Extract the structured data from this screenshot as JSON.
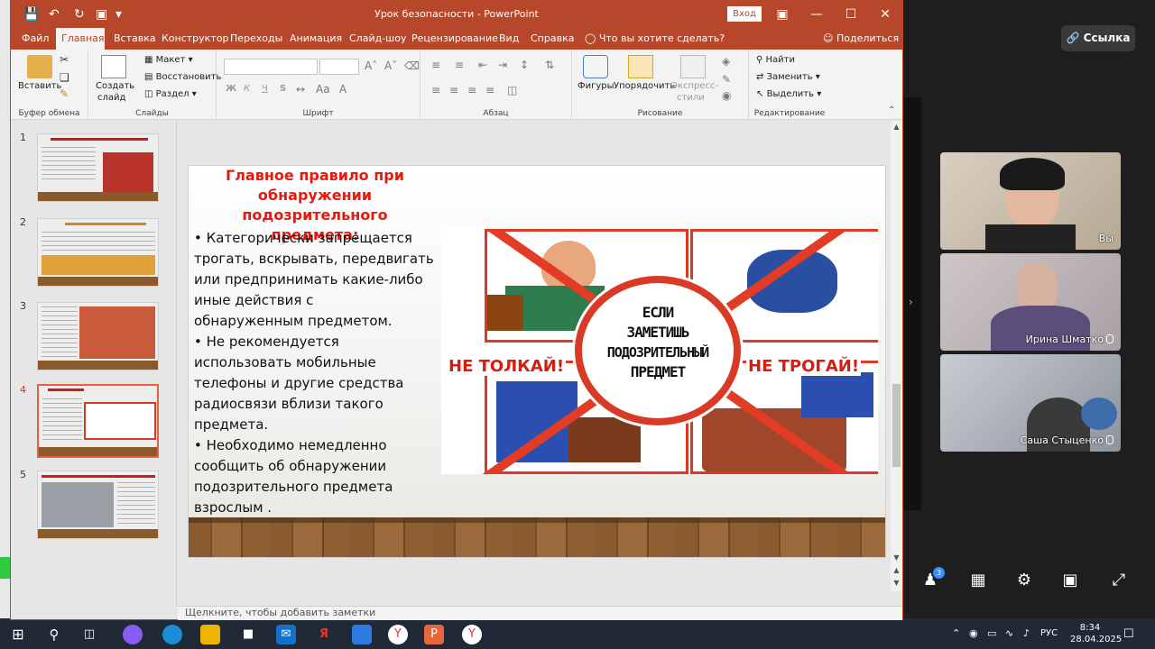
{
  "window": {
    "title": "Урок безопасности  -  PowerPoint",
    "signin": "Вход"
  },
  "tabs": [
    {
      "label": "Файл"
    },
    {
      "label": "Главная"
    },
    {
      "label": "Вставка"
    },
    {
      "label": "Конструктор"
    },
    {
      "label": "Переходы"
    },
    {
      "label": "Анимация"
    },
    {
      "label": "Слайд-шоу"
    },
    {
      "label": "Рецензирование"
    },
    {
      "label": "Вид"
    },
    {
      "label": "Справка"
    }
  ],
  "tell_me": "Что вы хотите сделать?",
  "share": "Поделиться",
  "ribbon": {
    "clipboard": {
      "paste": "Вставить",
      "label": "Буфер обмена"
    },
    "slides": {
      "new_slide_1": "Создать",
      "new_slide_2": "слайд",
      "layout": "Макет",
      "reset": "Восстановить",
      "section": "Раздел",
      "label": "Слайды"
    },
    "font": {
      "bold": "Ж",
      "italic": "К",
      "underline": "Ч",
      "strike": "S",
      "label": "Шрифт"
    },
    "paragraph": {
      "label": "Абзац"
    },
    "drawing": {
      "shapes": "Фигуры",
      "arrange": "Упорядочить",
      "styles_1": "Экспресс-",
      "styles_2": "стили",
      "label": "Рисование"
    },
    "editing": {
      "find": "Найти",
      "replace": "Заменить",
      "select": "Выделить",
      "label": "Редактирование"
    }
  },
  "slides": [
    {
      "number": "1",
      "selected": false
    },
    {
      "number": "2",
      "selected": false
    },
    {
      "number": "3",
      "selected": false
    },
    {
      "number": "4",
      "selected": true
    },
    {
      "number": "5",
      "selected": false
    }
  ],
  "slide": {
    "heading_1": "Главное правило при",
    "heading_2": "обнаружении подозрительного",
    "heading_3": "предмета:",
    "body": [
      "• Категорически запрещается",
      "трогать, вскрывать, передвигать",
      "или предпринимать какие-либо",
      "иные действия с",
      "обнаруженным предметом.",
      "• Не рекомендуется",
      "использовать мобильные",
      "телефоны и другие средства",
      "радиосвязи вблизи такого",
      "предмета.",
      "• Необходимо немедленно",
      "сообщить об обнаружении",
      "подозрительного предмета",
      "взрослым ."
    ],
    "poster": {
      "center_1": "ЕСЛИ",
      "center_2": "ЗАМЕТИШЬ",
      "center_3": "ПОДОЗРИТЕЛЬНЫЙ",
      "center_4": "ПРЕДМЕТ",
      "left": "НЕ ТОЛКАЙ!",
      "right": "НЕ ТРОГАЙ!"
    }
  },
  "notes_placeholder": "Щелкните, чтобы добавить заметки",
  "meeting": {
    "link_button": "Ссылка",
    "participants": [
      {
        "name": "Вы",
        "muted": false
      },
      {
        "name": "Ирина Шматко",
        "muted": true
      },
      {
        "name": "Саша Стыценко",
        "muted": true
      }
    ],
    "participants_badge": "3"
  },
  "taskbar": {
    "lang": "РУС",
    "time": "8:34",
    "date": "28.04.2025"
  },
  "colors": {
    "ppt_accent": "#b7472a",
    "heading_red": "#e8190f"
  }
}
